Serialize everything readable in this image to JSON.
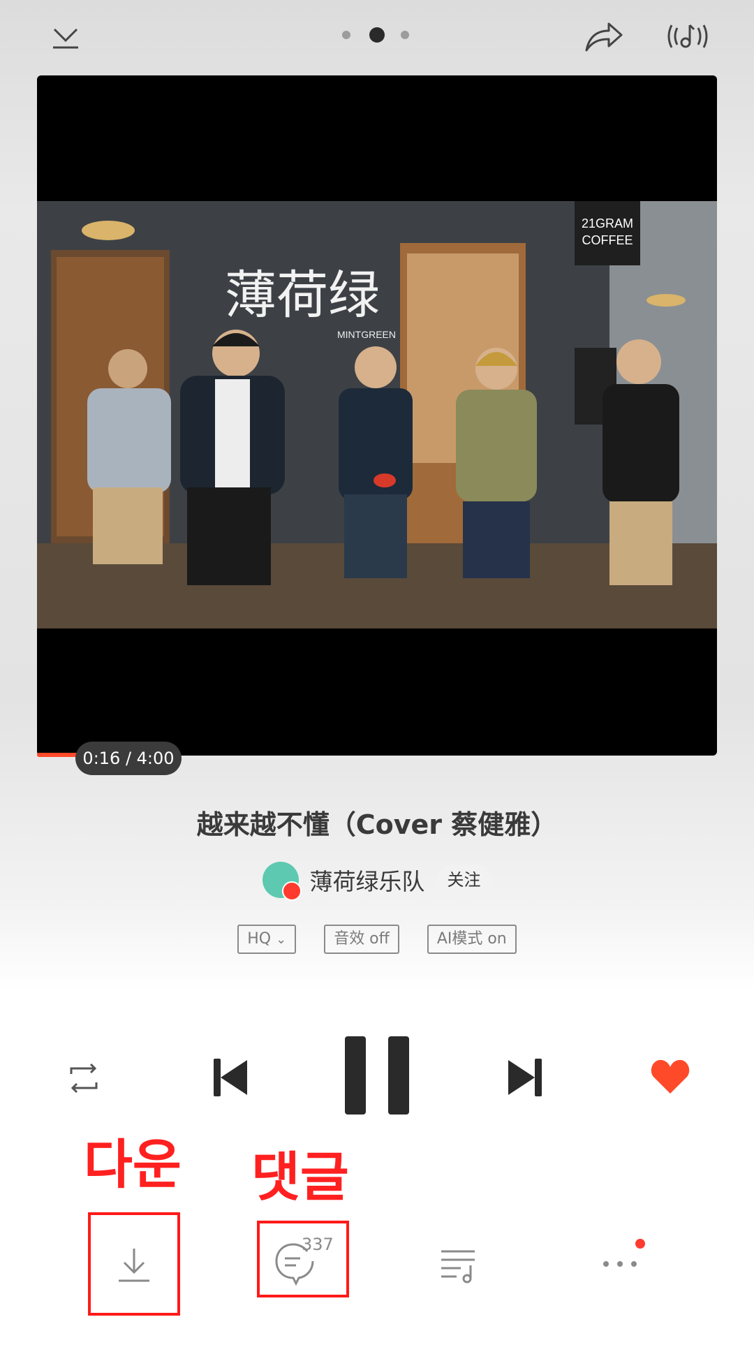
{
  "header": {
    "collapse_icon": "chevron-down-icon",
    "page_indicator": {
      "total": 3,
      "active_index": 1
    },
    "share_icon": "share-icon",
    "sound_icon": "sound-effect-icon"
  },
  "video": {
    "thumbnail_text": "薄荷绿",
    "thumbnail_subtext": "MINTGREEN",
    "sign_line1": "21GRAM",
    "sign_line2": "COFFEE",
    "time_display": "0:16 / 4:00",
    "progress": 0.067
  },
  "song": {
    "title": "越来越不懂（Cover 蔡健雅）",
    "artist": "薄荷绿乐队",
    "follow_label": "关注"
  },
  "options": {
    "quality": "HQ",
    "effect": "音效 off",
    "ai_mode": "AI模式 on"
  },
  "controls": {
    "repeat_icon": "repeat-icon",
    "prev_icon": "previous-icon",
    "pause_icon": "pause-icon",
    "next_icon": "next-icon",
    "like_icon": "heart-icon",
    "like_color": "#ff4a2a"
  },
  "annotations": {
    "download_label": "다운",
    "comment_label": "댓글"
  },
  "actions": {
    "download_icon": "download-icon",
    "comment_icon": "comment-icon",
    "comment_count": "337",
    "playlist_icon": "playlist-icon",
    "more_icon": "more-icon"
  },
  "colors": {
    "accent": "#ff4a2a",
    "annotation": "#ff1a1a"
  }
}
